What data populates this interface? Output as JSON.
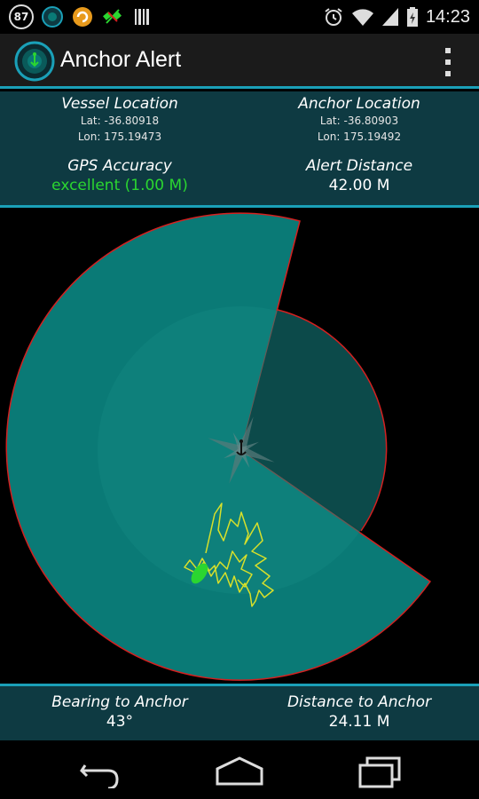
{
  "status_bar": {
    "notification_badge": "87",
    "time": "14:23",
    "icons": [
      "anchor-alert-icon",
      "sync-icon",
      "satellite-icon",
      "barcode-icon",
      "alarm-icon",
      "wifi-icon",
      "signal-icon",
      "battery-icon"
    ]
  },
  "action_bar": {
    "title": "Anchor Alert",
    "app_icon": "radar-icon",
    "menu_icon": "overflow-menu-icon"
  },
  "info": {
    "vessel_location_label": "Vessel Location",
    "vessel_lat": "Lat: -36.80918",
    "vessel_lon": "Lon: 175.19473",
    "anchor_location_label": "Anchor Location",
    "anchor_lat": "Lat: -36.80903",
    "anchor_lon": "Lon: 175.19492",
    "gps_accuracy_label": "GPS Accuracy",
    "gps_accuracy_value": "excellent (1.00 M)",
    "alert_distance_label": "Alert Distance",
    "alert_distance_value": "42.00 M"
  },
  "bottom": {
    "bearing_label": "Bearing to Anchor",
    "bearing_value": "43°",
    "distance_label": "Distance to Anchor",
    "distance_value": "24.11 M"
  },
  "nav": {
    "back": "back-icon",
    "home": "home-icon",
    "recents": "recents-icon"
  },
  "colors": {
    "accent": "#1aa0b8",
    "panel": "#0e3a42",
    "zone": "#0a7a76",
    "zone_light": "#13857f",
    "alert_ring": "#d42020",
    "track": "#d8e02a",
    "good": "#2bd630"
  }
}
